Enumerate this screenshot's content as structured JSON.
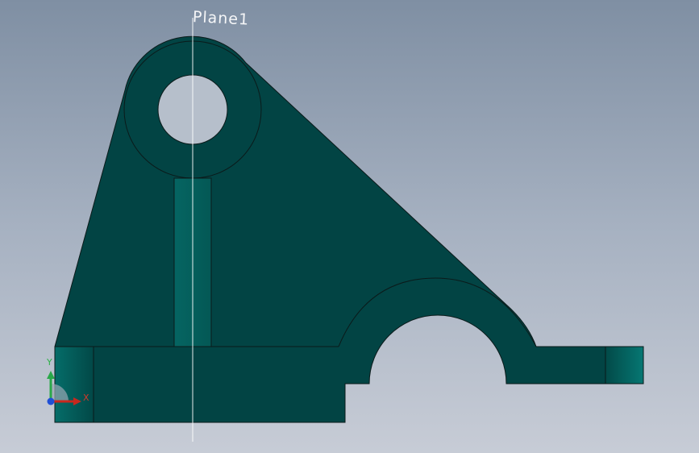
{
  "viewport": {
    "plane_label": "Plane1"
  },
  "triad": {
    "x_label": "X",
    "y_label": "Y",
    "colors": {
      "x": "#c8281e",
      "y": "#2aa84a",
      "z": "#1f4fd6"
    }
  },
  "part": {
    "face_color": "#024444",
    "side_color": "#04605c",
    "edge_color": "#0b1a1a"
  },
  "background": {
    "top": "#7f8fa3",
    "bottom": "#c7ccd6"
  }
}
